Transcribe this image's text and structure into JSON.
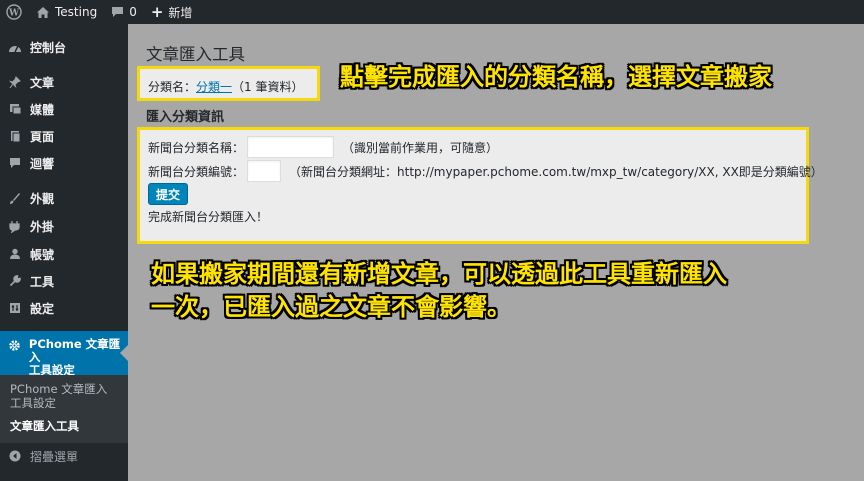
{
  "adminbar": {
    "site_name": "Testing",
    "comments_count": "0",
    "new_label": "新增"
  },
  "sidebar": {
    "items": [
      {
        "label": "控制台",
        "icon": "dashboard-icon"
      },
      {
        "label": "文章",
        "icon": "pin-icon"
      },
      {
        "label": "媒體",
        "icon": "media-icon"
      },
      {
        "label": "頁面",
        "icon": "page-icon"
      },
      {
        "label": "迴響",
        "icon": "comment-icon"
      },
      {
        "label": "外觀",
        "icon": "brush-icon"
      },
      {
        "label": "外掛",
        "icon": "plugin-icon"
      },
      {
        "label": "帳號",
        "icon": "user-icon"
      },
      {
        "label": "工具",
        "icon": "wrench-icon"
      },
      {
        "label": "設定",
        "icon": "settings-icon"
      }
    ],
    "active": {
      "line1": "PChome 文章匯入",
      "line2": "工具設定"
    },
    "submenu": [
      {
        "line1": "PChome 文章匯入",
        "line2": "工具設定"
      },
      {
        "line1": "文章匯入工具",
        "line2": ""
      }
    ],
    "collapse_label": "摺疊選單"
  },
  "main": {
    "title": "文章匯入工具",
    "category_label": "分類名：",
    "category_link": "分類一",
    "category_count": "（1 筆資料）",
    "section_title": "匯入分類資訊",
    "field1_label": "新聞台分類名稱：",
    "field1_value": "",
    "field1_hint": "（識別當前作業用，可隨意）",
    "field2_label": "新聞台分類編號：",
    "field2_value": "",
    "field2_hint": "（新聞台分類網址：http://mypaper.pchome.com.tw/mxp_tw/category/XX, XX即是分類編號）",
    "submit_label": "提交",
    "done_message": "完成新聞台分類匯入！"
  },
  "annotations": {
    "top": "點擊完成匯入的分類名稱，選擇文章搬家",
    "bottom_line1": "如果搬家期間還有新增文章，可以透過此工具重新匯入",
    "bottom_line2": "一次，已匯入過之文章不會影響。"
  },
  "colors": {
    "admin_bg": "#23282d",
    "active_menu": "#0073aa",
    "highlight_border": "#f5d90d",
    "annotation_text": "#ffe400",
    "overlay_bg": "#a7a7a7"
  }
}
